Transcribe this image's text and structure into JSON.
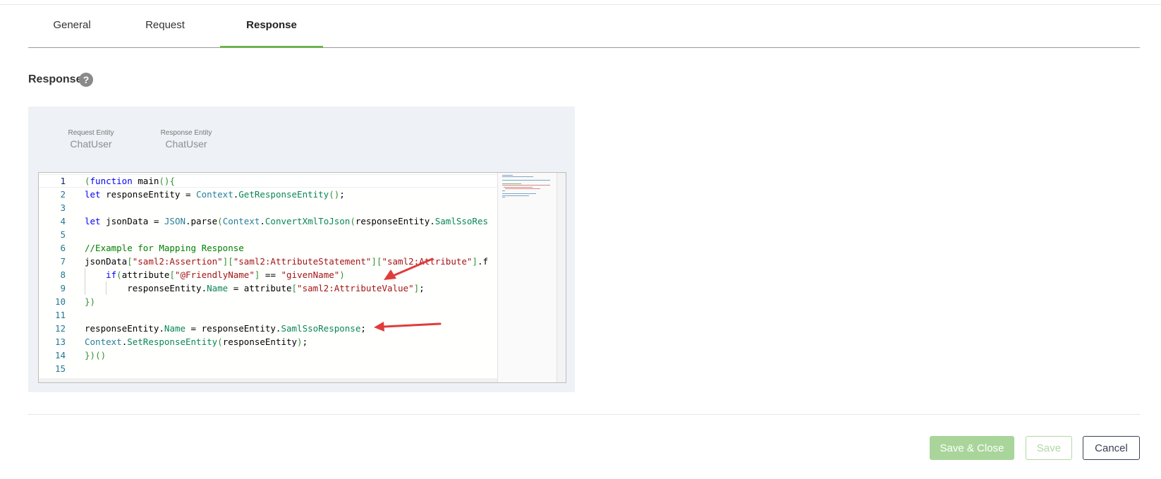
{
  "tabs": [
    {
      "label": "General",
      "active": false
    },
    {
      "label": "Request",
      "active": false
    },
    {
      "label": "Response",
      "active": true
    }
  ],
  "section": {
    "title": "Response",
    "help_icon": "?"
  },
  "entities": {
    "request": {
      "label": "Request Entity",
      "value": "ChatUser"
    },
    "response": {
      "label": "Response Entity",
      "value": "ChatUser"
    }
  },
  "editor": {
    "language": "javascript",
    "current_line": 1,
    "lines": [
      "(function main(){",
      "let responseEntity = Context.GetResponseEntity();",
      "",
      "let jsonData = JSON.parse(Context.ConvertXmlToJson(responseEntity.SamlSsoRes",
      "",
      "//Example for Mapping Response",
      "jsonData[\"saml2:Assertion\"][\"saml2:AttributeStatement\"][\"saml2:Attribute\"].f",
      "    if(attribute[\"@FriendlyName\"] == \"givenName\")",
      "        responseEntity.Name = attribute[\"saml2:AttributeValue\"];",
      "})",
      "",
      "responseEntity.Name = responseEntity.SamlSsoResponse;",
      "Context.SetResponseEntity(responseEntity);",
      "})()",
      ""
    ]
  },
  "annotations": {
    "arrow_color": "#e03c3c"
  },
  "buttons": {
    "save_close": "Save & Close",
    "save": "Save",
    "cancel": "Cancel"
  },
  "colors": {
    "accent": "#6db24e",
    "accent_disabled": "#a9d59a",
    "cancel_border": "#3b4256"
  }
}
